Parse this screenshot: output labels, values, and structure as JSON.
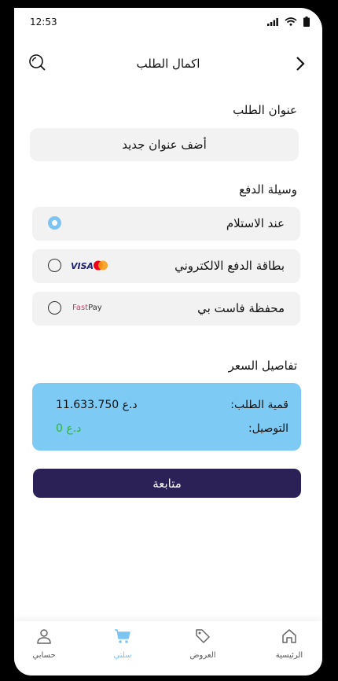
{
  "status_bar": {
    "time": "12:53"
  },
  "header": {
    "title": "اكمال الطلب"
  },
  "address": {
    "section_label": "عنوان الطلب",
    "add_new": "أضف عنوان جديد"
  },
  "payment": {
    "section_label": "وسيلة الدفع",
    "options": [
      {
        "label": "عند الاستلام",
        "selected": true
      },
      {
        "label": "بطاقة الدفع الالكتروني",
        "selected": false,
        "brand": "VISA"
      },
      {
        "label": "محفظة فاست بي",
        "selected": false,
        "brand_a": "Fast",
        "brand_b": "Pay"
      }
    ]
  },
  "price_details": {
    "section_label": "تفاصيل السعر",
    "order_value_label": "قمية الطلب:",
    "order_value": "11.633.750",
    "order_currency": "د.ع",
    "delivery_label": "التوصيل:",
    "delivery_value": "0",
    "delivery_currency": "د.ع"
  },
  "continue_label": "متابعة",
  "bottom_nav": {
    "home": "الرئيسية",
    "offers": "العروض",
    "cart": "سلتي",
    "account": "حسابي"
  },
  "colors": {
    "accent": "#7cc5f2",
    "primary": "#2b2156",
    "card": "#7dcbf5",
    "green": "#2fb52f"
  }
}
